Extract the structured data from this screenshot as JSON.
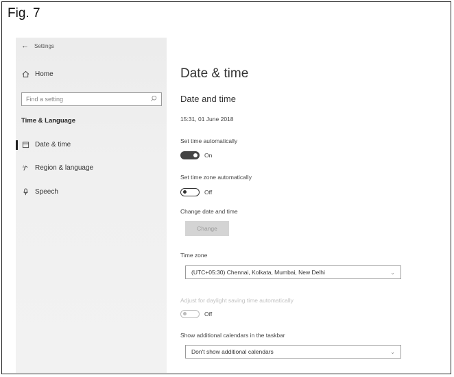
{
  "figure_label": "Fig. 7",
  "window": {
    "title": "Settings"
  },
  "sidebar": {
    "home_label": "Home",
    "search_placeholder": "Find a setting",
    "section_title": "Time & Language",
    "items": [
      {
        "label": "Date & time",
        "icon": "calendar-icon"
      },
      {
        "label": "Region & language",
        "icon": "region-icon"
      },
      {
        "label": "Speech",
        "icon": "microphone-icon"
      }
    ]
  },
  "main": {
    "page_title": "Date & time",
    "section_title": "Date and time",
    "current_datetime": "15:31, 01 June 2018",
    "set_time_auto": {
      "label": "Set time automatically",
      "state": "On"
    },
    "set_timezone_auto": {
      "label": "Set time zone automatically",
      "state": "Off"
    },
    "change_datetime": {
      "label": "Change date and time",
      "button": "Change"
    },
    "time_zone": {
      "label": "Time zone",
      "value": "(UTC+05:30) Chennai, Kolkata, Mumbai, New Delhi"
    },
    "daylight": {
      "label": "Adjust for daylight saving time automatically",
      "state": "Off"
    },
    "calendars": {
      "label": "Show additional calendars in the taskbar",
      "value": "Don't show additional calendars"
    }
  }
}
